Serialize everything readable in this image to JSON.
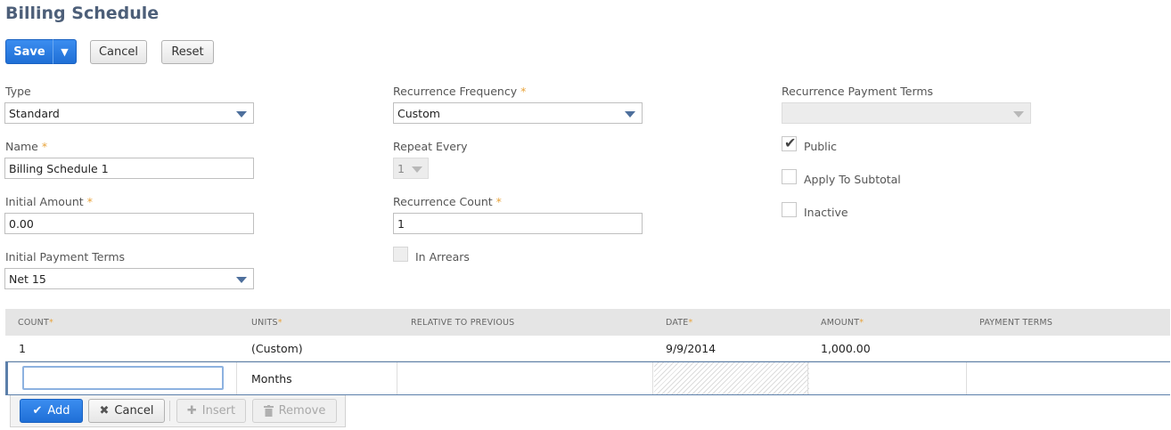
{
  "page": {
    "title": "Billing Schedule"
  },
  "toolbar": {
    "save_label": "Save",
    "save_menu_glyph": "▼",
    "cancel_label": "Cancel",
    "reset_label": "Reset"
  },
  "form": {
    "type": {
      "label": "Type",
      "value": "Standard"
    },
    "name": {
      "label": "Name",
      "required": "*",
      "value": "Billing Schedule 1"
    },
    "initial_amount": {
      "label": "Initial Amount",
      "required": "*",
      "value": "0.00"
    },
    "initial_payment_terms": {
      "label": "Initial Payment Terms",
      "value": "Net 15"
    },
    "recurrence_frequency": {
      "label": "Recurrence Frequency",
      "required": "*",
      "value": "Custom"
    },
    "repeat_every": {
      "label": "Repeat Every",
      "value": "1"
    },
    "recurrence_count": {
      "label": "Recurrence Count",
      "required": "*",
      "value": "1"
    },
    "in_arrears": {
      "label": "In Arrears",
      "checked": false
    },
    "recurrence_payment_terms": {
      "label": "Recurrence Payment Terms",
      "value": ""
    },
    "public": {
      "label": "Public",
      "checked": true
    },
    "apply_to_subtotal": {
      "label": "Apply To Subtotal",
      "checked": false
    },
    "inactive": {
      "label": "Inactive",
      "checked": false
    }
  },
  "grid": {
    "columns": [
      "COUNT",
      "UNITS",
      "RELATIVE TO PREVIOUS",
      "DATE",
      "AMOUNT",
      "PAYMENT TERMS"
    ],
    "required_mark": "*",
    "rows": [
      {
        "count": "1",
        "units": "(Custom)",
        "relative": "",
        "date": "9/9/2014",
        "amount": "1,000.00",
        "terms": ""
      }
    ],
    "edit_row": {
      "count": "",
      "units": "Months"
    }
  },
  "row_actions": {
    "add_label": "Add",
    "cancel_label": "Cancel",
    "insert_label": "Insert",
    "remove_label": "Remove"
  },
  "colors": {
    "title": "#4d5f79",
    "primary": "#1f6fd6",
    "required": "#e8a33a",
    "edit_row_border": "#5b7faa"
  },
  "icons": {
    "save_dropdown": "chevron-down-icon",
    "select_caret": "caret-down-icon",
    "check": "check-icon",
    "add": "check-icon",
    "cancel": "close-icon",
    "insert": "plus-icon",
    "remove": "trash-icon"
  }
}
